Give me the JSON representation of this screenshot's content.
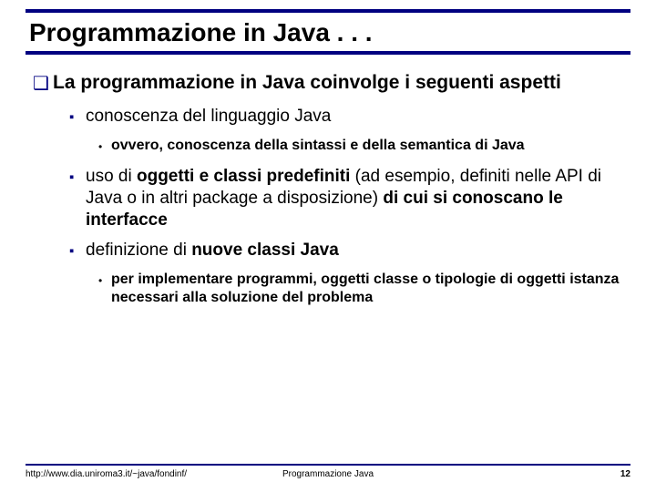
{
  "title": "Programmazione in Java . . .",
  "lvl1": "La programmazione in Java coinvolge i seguenti aspetti",
  "lvl2a": "conoscenza del linguaggio Java",
  "lvl3a": "ovvero, conoscenza della sintassi e della semantica di Java",
  "lvl2b_pre": "uso di ",
  "lvl2b_b1": "oggetti e classi predefiniti",
  "lvl2b_mid": " (ad esempio, definiti nelle API di Java o in altri package a disposizione) ",
  "lvl2b_b2": "di cui si conoscano le interfacce",
  "lvl2c_pre": "definizione di ",
  "lvl2c_b": "nuove classi Java",
  "lvl3b": "per implementare programmi, oggetti classe o tipologie di oggetti istanza necessari alla soluzione del problema",
  "footer_left": "http://www.dia.uniroma3.it/~java/fondinf/",
  "footer_center": "Programmazione Java",
  "footer_right": "12"
}
